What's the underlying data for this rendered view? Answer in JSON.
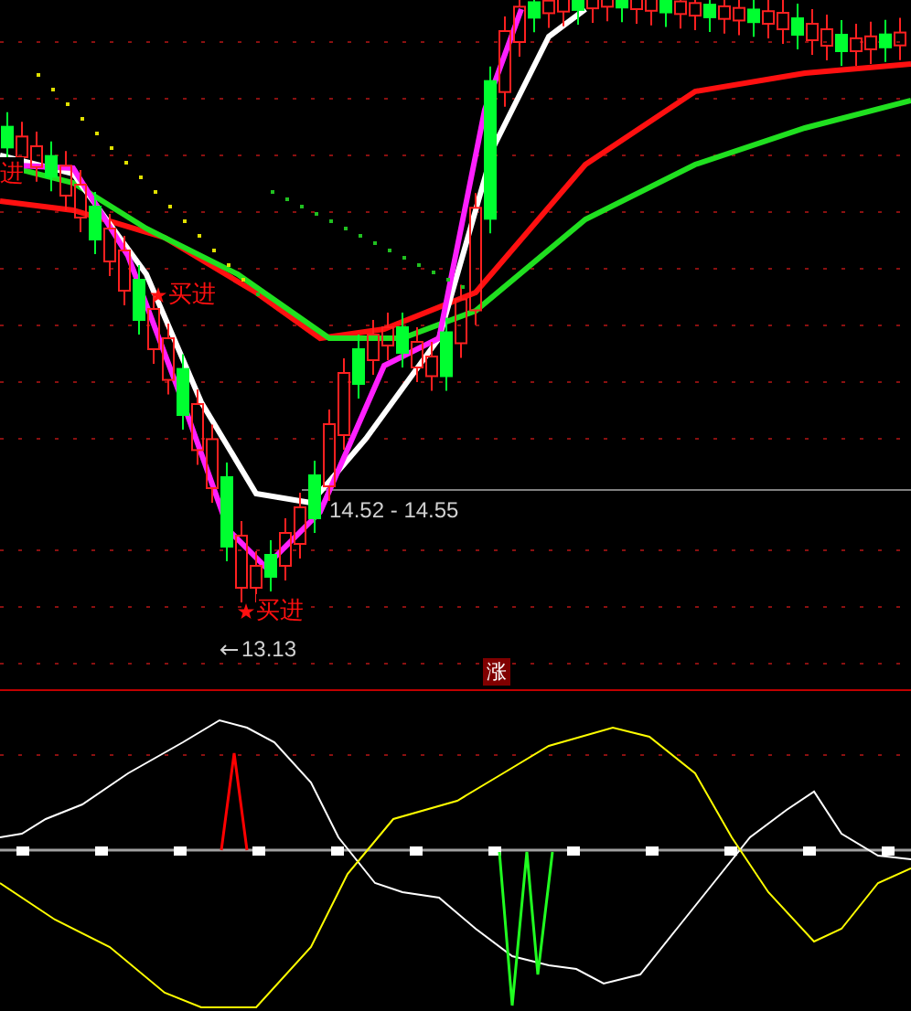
{
  "main_panel": {
    "signals": [
      {
        "label": "进"
      },
      {
        "label": "买进"
      },
      {
        "label": "买进"
      }
    ],
    "price_range_label": "14.52 - 14.55",
    "low_price_label": "13.13",
    "badge": "涨"
  }
}
